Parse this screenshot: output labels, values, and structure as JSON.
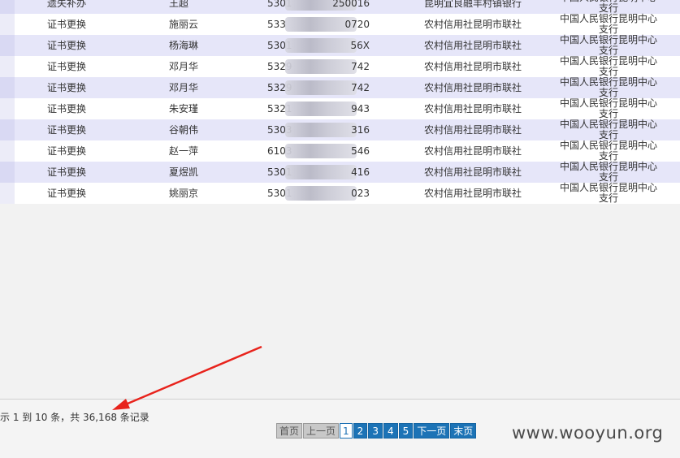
{
  "rows": [
    {
      "type": "遗失补办",
      "name": "王超",
      "id_prefix": "5301",
      "id_suffix": "250016",
      "org": "昆明宜良融丰村镇银行",
      "bank": "中国人民银行昆明中心支行"
    },
    {
      "type": "证书更换",
      "name": "施丽云",
      "id_prefix": "533",
      "id_suffix": "0720",
      "org": "农村信用社昆明市联社",
      "bank": "中国人民银行昆明中心支行"
    },
    {
      "type": "证书更换",
      "name": "杨海琳",
      "id_prefix": "5301",
      "id_suffix": "56X",
      "org": "农村信用社昆明市联社",
      "bank": "中国人民银行昆明中心支行"
    },
    {
      "type": "证书更换",
      "name": "邓月华",
      "id_prefix": "5329",
      "id_suffix": "742",
      "org": "农村信用社昆明市联社",
      "bank": "中国人民银行昆明中心支行"
    },
    {
      "type": "证书更换",
      "name": "邓月华",
      "id_prefix": "5329",
      "id_suffix": "742",
      "org": "农村信用社昆明市联社",
      "bank": "中国人民银行昆明中心支行"
    },
    {
      "type": "证书更换",
      "name": "朱安瑾",
      "id_prefix": "5321",
      "id_suffix": "943",
      "org": "农村信用社昆明市联社",
      "bank": "中国人民银行昆明中心支行"
    },
    {
      "type": "证书更换",
      "name": "谷朝伟",
      "id_prefix": "5303",
      "id_suffix": "316",
      "org": "农村信用社昆明市联社",
      "bank": "中国人民银行昆明中心支行"
    },
    {
      "type": "证书更换",
      "name": "赵一萍",
      "id_prefix": "6103",
      "id_suffix": "546",
      "org": "农村信用社昆明市联社",
      "bank": "中国人民银行昆明中心支行"
    },
    {
      "type": "证书更换",
      "name": "夏煜凯",
      "id_prefix": "5301",
      "id_suffix": "416",
      "org": "农村信用社昆明市联社",
      "bank": "中国人民银行昆明中心支行"
    },
    {
      "type": "证书更换",
      "name": "姚丽京",
      "id_prefix": "5301",
      "id_suffix": "023",
      "org": "农村信用社昆明市联社",
      "bank": "中国人民银行昆明中心支行"
    }
  ],
  "footer": {
    "record_info": "示 1 到 10 条，共 36,168 条记录"
  },
  "pager": {
    "first": "首页",
    "prev": "上一页",
    "pages": [
      "1",
      "2",
      "3",
      "4",
      "5"
    ],
    "next": "下一页",
    "last": "末页",
    "current_page": 1
  },
  "watermark": "www.wooyun.org",
  "colors": {
    "row_odd": "#e6e6f9",
    "row_even": "#ffffff",
    "pager_blue": "#1c73b6",
    "arrow_red": "#e8231c"
  }
}
